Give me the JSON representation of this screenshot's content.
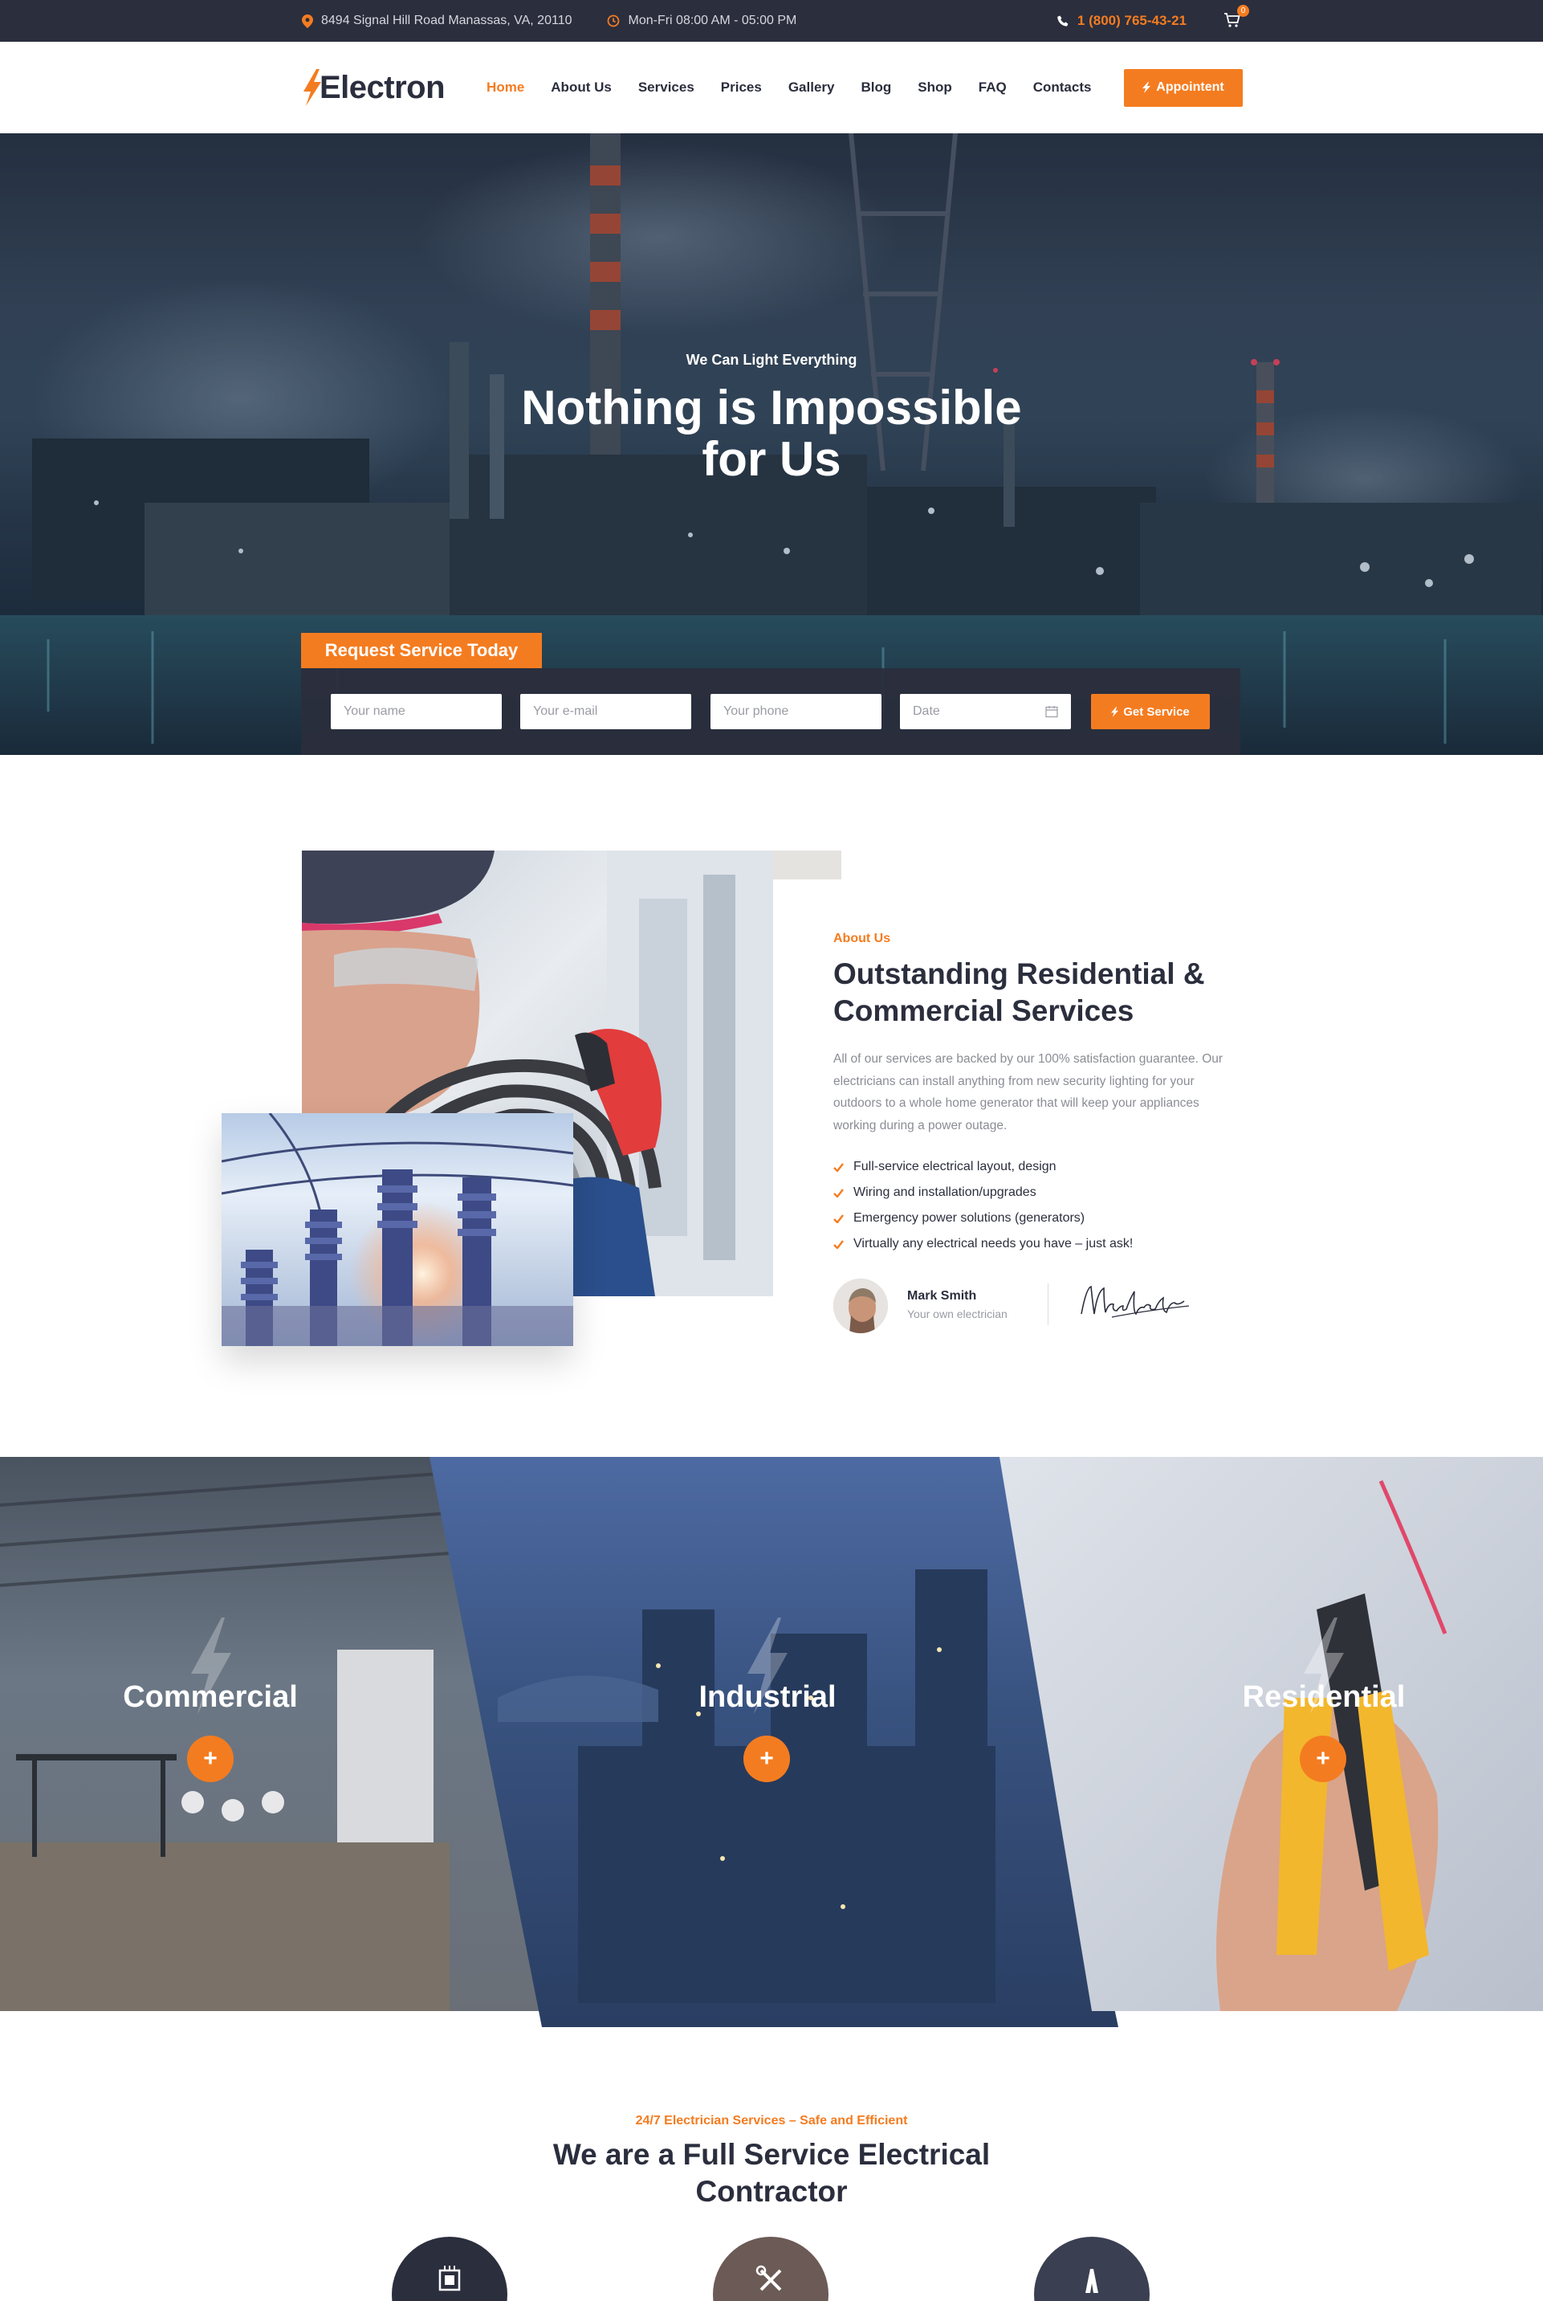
{
  "topbar": {
    "address": "8494 Signal Hill Road Manassas, VA, 20110",
    "hours": "Mon-Fri 08:00 AM - 05:00 PM",
    "phone": "1 (800) 765-43-21",
    "cart_count": "0"
  },
  "header": {
    "logo": "Electron",
    "nav": [
      "Home",
      "About Us",
      "Services",
      "Prices",
      "Gallery",
      "Blog",
      "Shop",
      "FAQ",
      "Contacts"
    ],
    "active_nav": "Home",
    "cta": "Appointent"
  },
  "hero": {
    "subtitle": "We Can Light Everything",
    "title_line1": "Nothing is Impossible",
    "title_line2": "for Us",
    "form": {
      "tab_label": "Request Service Today",
      "name_placeholder": "Your name",
      "email_placeholder": "Your e-mail",
      "phone_placeholder": "Your phone",
      "date_placeholder": "Date",
      "submit": "Get Service"
    }
  },
  "about": {
    "label": "About Us",
    "title": "Outstanding Residential & Commercial Services",
    "text": "All of our services are backed by our 100% satisfaction guarantee. Our electricians can install anything from new security lighting for your outdoors to a whole home generator that will keep your appliances working during a power outage.",
    "list": [
      "Full-service electrical layout, design",
      "Wiring and installation/upgrades",
      "Emergency power solutions (generators)",
      "Virtually any electrical needs you have – just ask!"
    ],
    "person_name": "Mark Smith",
    "person_role": "Your own electrician",
    "signature": "MarkSmith"
  },
  "panels": [
    {
      "title": "Commercial",
      "button": "+"
    },
    {
      "title": "Industrial",
      "button": "+"
    },
    {
      "title": "Residential",
      "button": "+"
    }
  ],
  "contractor": {
    "label": "24/7 Electrician Services – Safe and Efficient",
    "title_line1": "We are a Full Service Electrical",
    "title_line2": "Contractor"
  },
  "colors": {
    "accent": "#f47c20",
    "dark": "#2b2e3d",
    "text_muted": "#8b8d95"
  }
}
